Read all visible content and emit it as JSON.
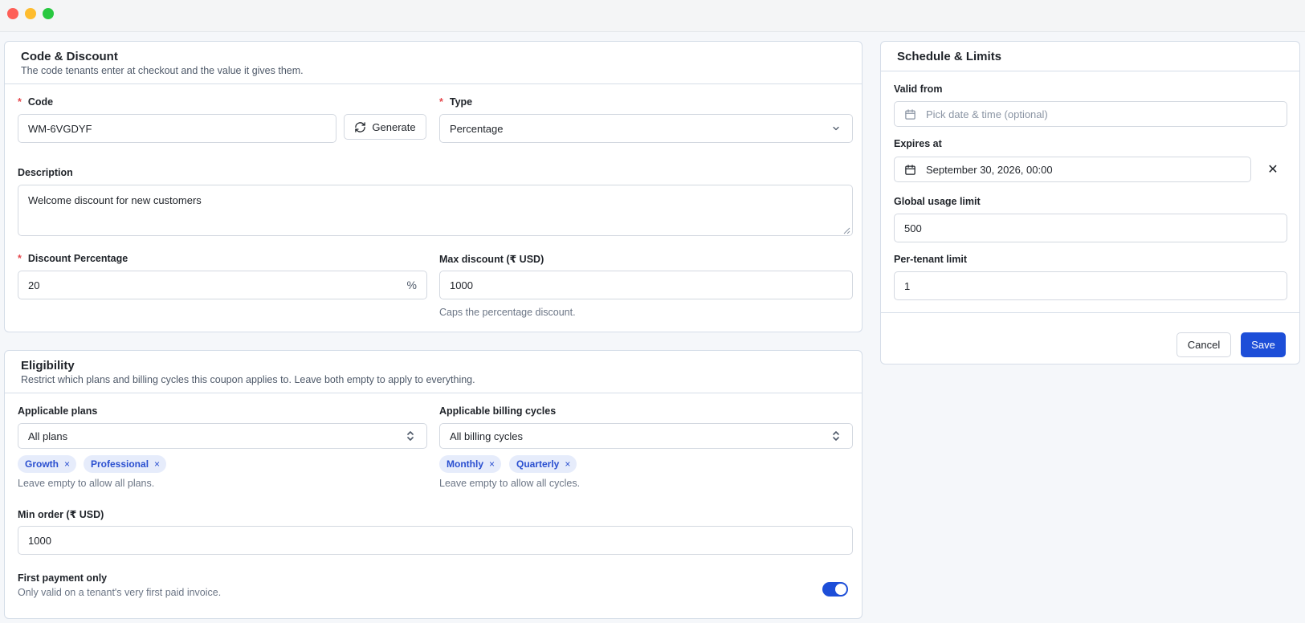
{
  "code_discount": {
    "title": "Code & Discount",
    "subtitle": "The code tenants enter at checkout and the value it gives them.",
    "code_label": "Code",
    "code_value": "WM-6VGDYF",
    "generate_label": "Generate",
    "type_label": "Type",
    "type_value": "Percentage",
    "description_label": "Description",
    "description_value": "Welcome discount for new customers",
    "discount_pct_label": "Discount Percentage",
    "discount_pct_value": "20",
    "discount_pct_suffix": "%",
    "max_discount_label": "Max discount (₹ USD)",
    "max_discount_value": "1000",
    "max_discount_hint": "Caps the percentage discount.",
    "required_mark": "*"
  },
  "eligibility": {
    "title": "Eligibility",
    "subtitle": "Restrict which plans and billing cycles this coupon applies to. Leave both empty to apply to everything.",
    "plans_label": "Applicable plans",
    "plans_value": "All plans",
    "plans_tags": [
      "Growth",
      "Professional"
    ],
    "plans_hint": "Leave empty to allow all plans.",
    "cycles_label": "Applicable billing cycles",
    "cycles_value": "All billing cycles",
    "cycles_tags": [
      "Monthly",
      "Quarterly"
    ],
    "cycles_hint": "Leave empty to allow all cycles.",
    "min_order_label": "Min order (₹ USD)",
    "min_order_value": "1000",
    "first_payment_label": "First payment only",
    "first_payment_hint": "Only valid on a tenant's very first paid invoice.",
    "first_payment_on": true,
    "tag_remove": "×"
  },
  "schedule": {
    "title": "Schedule & Limits",
    "valid_from_label": "Valid from",
    "valid_from_placeholder": "Pick date & time (optional)",
    "expires_label": "Expires at",
    "expires_value": "September 30, 2026, 00:00",
    "clear_glyph": "✕",
    "global_limit_label": "Global usage limit",
    "global_limit_value": "500",
    "per_tenant_label": "Per-tenant limit",
    "per_tenant_value": "1",
    "cancel_label": "Cancel",
    "save_label": "Save"
  },
  "colors": {
    "accent": "#1d4ed8",
    "required": "#e5484d",
    "tag_bg": "#e6ecfb"
  }
}
